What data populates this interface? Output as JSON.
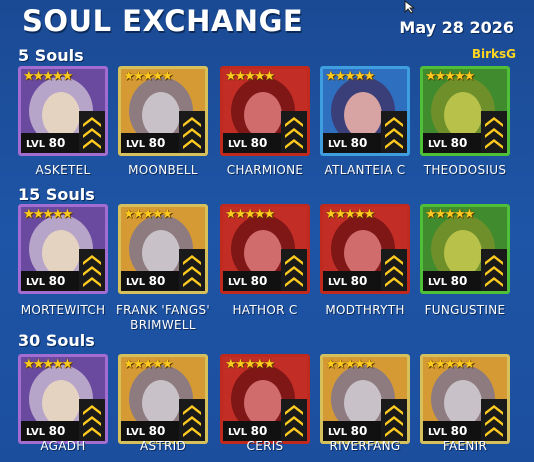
{
  "header": {
    "title": "SOUL EXCHANGE",
    "date": "May 28 2026",
    "author": "BirksG"
  },
  "colors": {
    "background": "#1e55a6",
    "star": "#ffcb1f",
    "author": "#ffd51e",
    "border_epic": "#a36cd0",
    "border_legendary": "#d6c05c",
    "border_mythical": "#c0291e",
    "border_rare": "#3f9ee0",
    "border_green": "#4fbf38"
  },
  "sections": [
    {
      "label": "5 Souls",
      "champions": [
        {
          "name": "ASKETEL",
          "level_prefix": "LVL",
          "level": "80",
          "stars": 5,
          "icon": "champion-portrait",
          "border": "epic"
        },
        {
          "name": "MOONBELL",
          "level_prefix": "LVL",
          "level": "80",
          "stars": 5,
          "icon": "champion-portrait",
          "border": "legendary"
        },
        {
          "name": "CHARMIONE",
          "level_prefix": "LVL",
          "level": "80",
          "stars": 5,
          "icon": "champion-portrait",
          "border": "mythical"
        },
        {
          "name": "ATLANTEIA C",
          "level_prefix": "LVL",
          "level": "80",
          "stars": 5,
          "icon": "champion-portrait",
          "border": "rare"
        },
        {
          "name": "THEODOSIUS",
          "level_prefix": "LVL",
          "level": "80",
          "stars": 5,
          "icon": "champion-portrait",
          "border": "green"
        }
      ]
    },
    {
      "label": "15 Souls",
      "champions": [
        {
          "name": "MORTEWITCH",
          "level_prefix": "LVL",
          "level": "80",
          "stars": 5,
          "icon": "champion-portrait",
          "border": "epic"
        },
        {
          "name": "FRANK 'FANGS' BRIMWELL",
          "level_prefix": "LVL",
          "level": "80",
          "stars": 5,
          "icon": "champion-portrait",
          "border": "legendary"
        },
        {
          "name": "HATHOR C",
          "level_prefix": "LVL",
          "level": "80",
          "stars": 5,
          "icon": "champion-portrait",
          "border": "mythical"
        },
        {
          "name": "MODTHRYTH",
          "level_prefix": "LVL",
          "level": "80",
          "stars": 5,
          "icon": "champion-portrait",
          "border": "mythical"
        },
        {
          "name": "FUNGUSTINE",
          "level_prefix": "LVL",
          "level": "80",
          "stars": 5,
          "icon": "champion-portrait",
          "border": "green"
        }
      ]
    },
    {
      "label": "30 Souls",
      "champions": [
        {
          "name": "AGADH",
          "level_prefix": "LVL",
          "level": "80",
          "stars": 5,
          "icon": "champion-portrait",
          "border": "epic"
        },
        {
          "name": "ASTRID",
          "level_prefix": "LVL",
          "level": "80",
          "stars": 5,
          "icon": "champion-portrait",
          "border": "legendary"
        },
        {
          "name": "CERIS",
          "level_prefix": "LVL",
          "level": "80",
          "stars": 5,
          "icon": "champion-portrait",
          "border": "mythical"
        },
        {
          "name": "RIVERFANG",
          "level_prefix": "LVL",
          "level": "80",
          "stars": 5,
          "icon": "champion-portrait",
          "border": "legendary"
        },
        {
          "name": "FAENIR",
          "level_prefix": "LVL",
          "level": "80",
          "stars": 5,
          "icon": "champion-portrait",
          "border": "legendary"
        }
      ]
    }
  ]
}
